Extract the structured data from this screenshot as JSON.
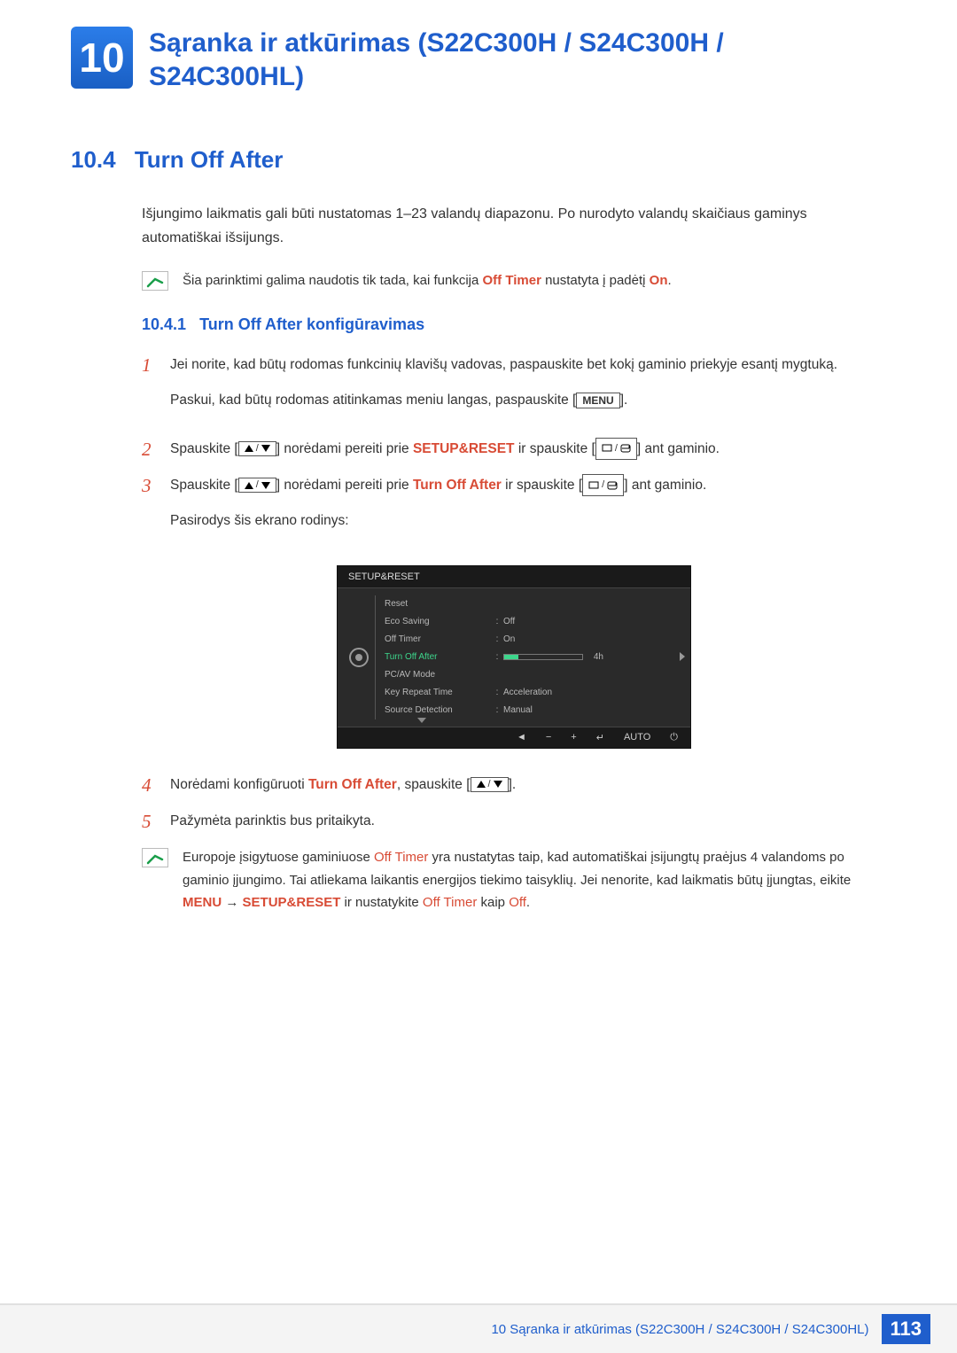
{
  "chapter": {
    "number": "10",
    "title": "Sąranka ir atkūrimas (S22C300H / S24C300H / S24C300HL)"
  },
  "section": {
    "number": "10.4",
    "title": "Turn Off After",
    "intro": "Išjungimo laikmatis gali būti nustatomas 1–23 valandų diapazonu. Po nurodyto valandų skaičiaus gaminys automatiškai išsijungs.",
    "note1_pre": "Šia parinktimi galima naudotis tik tada, kai funkcija ",
    "note1_hl1": "Off Timer",
    "note1_mid": " nustatyta į padėtį ",
    "note1_hl2": "On",
    "note1_post": "."
  },
  "subsection": {
    "number": "10.4.1",
    "title": "Turn Off After konfigūravimas"
  },
  "steps": {
    "s1_p1": "Jei norite, kad būtų rodomas funkcinių klavišų vadovas, paspauskite bet kokį gaminio priekyje esantį mygtuką.",
    "s1_p2_pre": "Paskui, kad būtų rodomas atitinkamas meniu langas, paspauskite [",
    "s1_p2_btn": "MENU",
    "s1_p2_post": "].",
    "s2_pre": "Spauskite [",
    "s2_mid1": "] norėdami pereiti prie ",
    "s2_hl": "SETUP&RESET",
    "s2_mid2": " ir spauskite [",
    "s2_post": "] ant gaminio.",
    "s3_pre": "Spauskite [",
    "s3_mid1": "] norėdami pereiti prie ",
    "s3_hl": "Turn Off After",
    "s3_mid2": " ir spauskite [",
    "s3_post": "] ant gaminio.",
    "s3_p2": "Pasirodys šis ekrano rodinys:",
    "s4_pre": "Norėdami konfigūruoti ",
    "s4_hl": "Turn Off After",
    "s4_mid": ", spauskite [",
    "s4_post": "].",
    "s5": "Pažymėta parinktis bus pritaikyta."
  },
  "note2": {
    "p_pre": "Europoje įsigytuose gaminiuose ",
    "p_hl1": "Off Timer",
    "p_mid1": " yra nustatytas taip, kad automatiškai įsijungtų praėjus 4 valandoms po gaminio įjungimo. Tai atliekama laikantis energijos tiekimo taisyklių. Jei nenorite, kad laikmatis būtų įjungtas, eikite ",
    "p_hl2": "MENU",
    "p_arrow": " → ",
    "p_hl3": "SETUP&RESET",
    "p_mid2": " ir nustatykite ",
    "p_hl4": "Off Timer",
    "p_mid3": " kaip ",
    "p_hl5": "Off",
    "p_post": "."
  },
  "osd": {
    "title": "SETUP&RESET",
    "rows": [
      {
        "label": "Reset",
        "value": ""
      },
      {
        "label": "Eco Saving",
        "value": "Off"
      },
      {
        "label": "Off Timer",
        "value": "On"
      },
      {
        "label": "Turn Off After",
        "value": "4h",
        "active": true
      },
      {
        "label": "PC/AV Mode",
        "value": ""
      },
      {
        "label": "Key Repeat Time",
        "value": "Acceleration"
      },
      {
        "label": "Source Detection",
        "value": "Manual"
      }
    ],
    "footer_auto": "AUTO"
  },
  "footer": {
    "text": "10 Sąranka ir atkūrimas (S22C300H / S24C300H / S24C300HL)",
    "page": "113"
  }
}
